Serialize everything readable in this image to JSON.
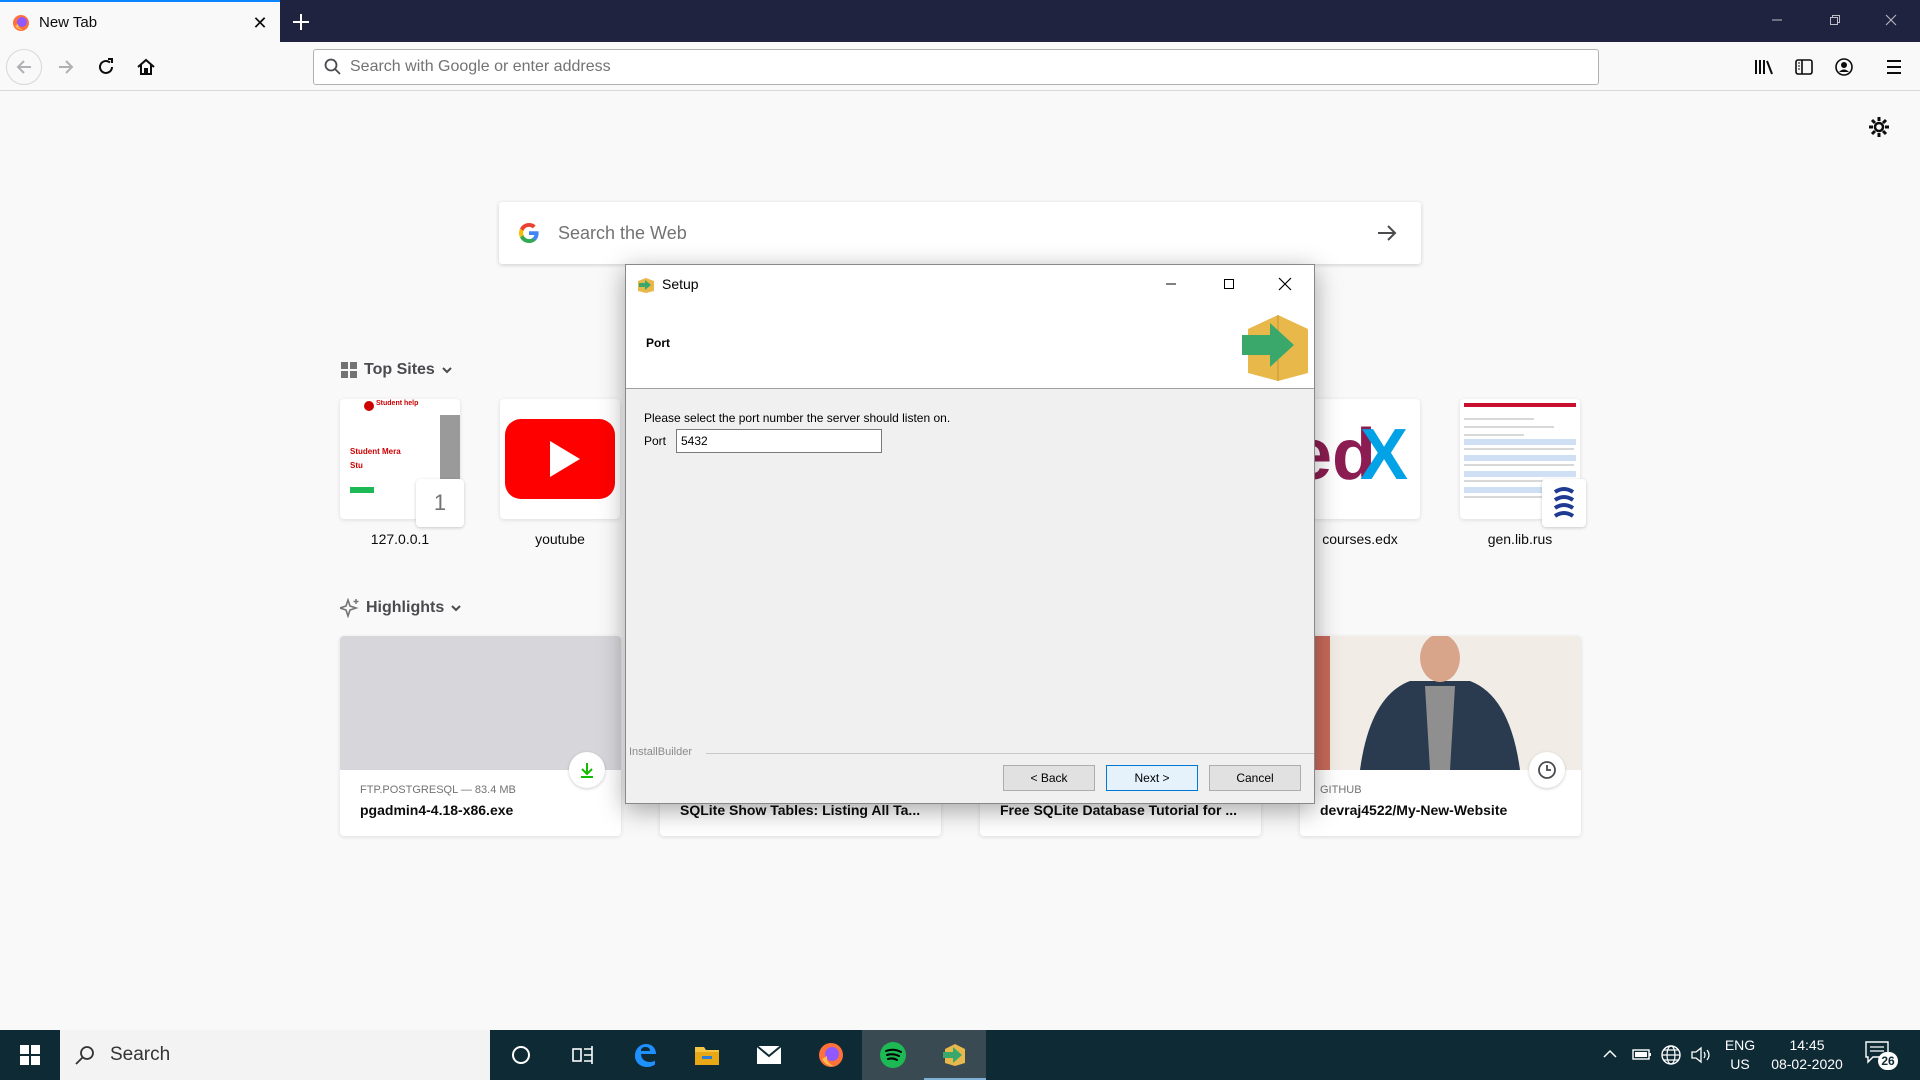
{
  "browser": {
    "tab_title": "New Tab",
    "url_placeholder": "Search with Google or enter address"
  },
  "newtab": {
    "search_placeholder": "Search the Web",
    "top_sites_title": "Top Sites",
    "top_sites": [
      {
        "label": "127.0.0.1",
        "badge": "1"
      },
      {
        "label": "youtube"
      },
      {
        "label": "courses.edx"
      },
      {
        "label": "gen.lib.rus"
      }
    ],
    "highlights_title": "Highlights",
    "highlights": [
      {
        "context": "FTP.POSTGRESQL — 83.4 MB",
        "title": "pgadmin4-4.18-x86.exe"
      },
      {
        "context": "",
        "title": "SQLite Show Tables: Listing All Ta..."
      },
      {
        "context": "",
        "title": "Free SQLite Database Tutorial for ..."
      },
      {
        "context": "GITHUB",
        "title": "devraj4522/My-New-Website"
      }
    ],
    "thumb_studenthelp": {
      "brand": "Student help",
      "line1": "Student Mera",
      "line2": "Stu"
    }
  },
  "dialog": {
    "title": "Setup",
    "header": "Port",
    "instruction": "Please select the port number the server should listen on.",
    "port_label": "Port",
    "port_value": "5432",
    "footer_brand": "InstallBuilder",
    "back_label": "< Back",
    "next_label": "Next >",
    "cancel_label": "Cancel"
  },
  "taskbar": {
    "search_label": "Search",
    "lang_line1": "ENG",
    "lang_line2": "US",
    "time": "14:45",
    "date": "08-02-2020",
    "notification_count": "26"
  },
  "colors": {
    "tabstrip": "#202340",
    "accent": "#0a84ff",
    "taskbar": "#0e2a35",
    "youtube_red": "#ff0000",
    "edx_blue": "#02a2e6"
  }
}
